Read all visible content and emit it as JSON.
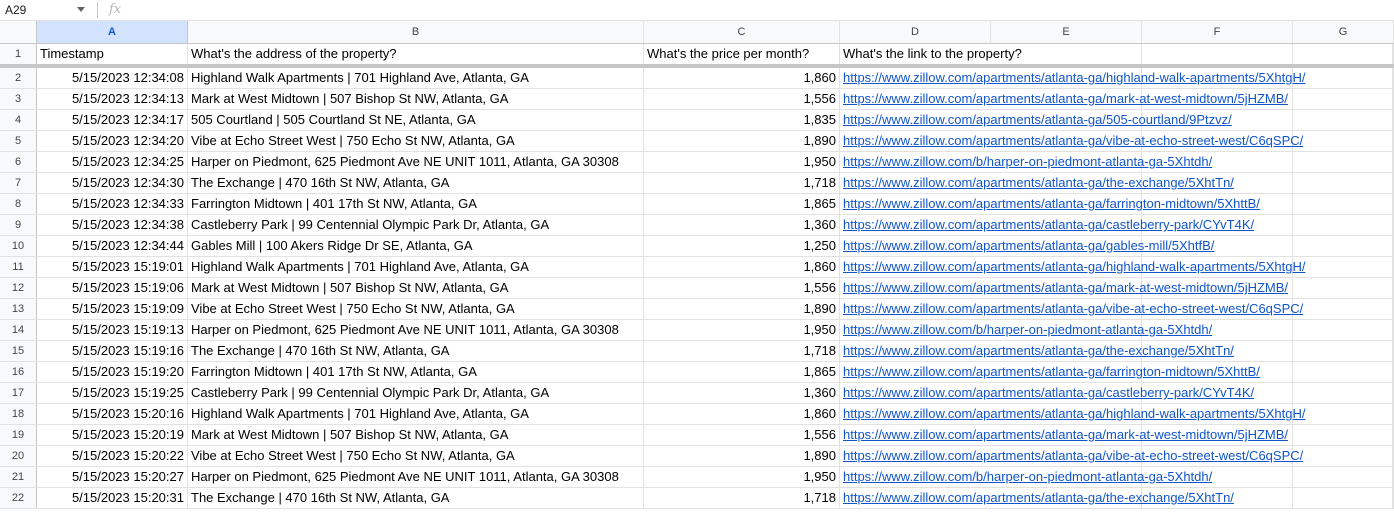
{
  "formula_bar": {
    "name_box": "A29",
    "fx_label": "fx",
    "formula": ""
  },
  "columns": [
    "A",
    "B",
    "C",
    "D",
    "E",
    "F",
    "G"
  ],
  "selected_column": "A",
  "header_row": {
    "row_number": "1",
    "A": "Timestamp",
    "B": "What's the address of the property?",
    "C": "What's the price per month?",
    "D": "What's the link to the property?"
  },
  "rows": [
    {
      "n": "2",
      "timestamp": "5/15/2023 12:34:08",
      "address": "Highland Walk Apartments | 701 Highland Ave, Atlanta, GA",
      "price": "1,860",
      "link": "https://www.zillow.com/apartments/atlanta-ga/highland-walk-apartments/5XhtgH/"
    },
    {
      "n": "3",
      "timestamp": "5/15/2023 12:34:13",
      "address": "Mark at West Midtown | 507 Bishop St NW, Atlanta, GA",
      "price": "1,556",
      "link": "https://www.zillow.com/apartments/atlanta-ga/mark-at-west-midtown/5jHZMB/"
    },
    {
      "n": "4",
      "timestamp": "5/15/2023 12:34:17",
      "address": "505 Courtland | 505 Courtland St NE, Atlanta, GA",
      "price": "1,835",
      "link": "https://www.zillow.com/apartments/atlanta-ga/505-courtland/9Ptzvz/"
    },
    {
      "n": "5",
      "timestamp": "5/15/2023 12:34:20",
      "address": "Vibe at Echo Street West | 750 Echo St NW, Atlanta, GA",
      "price": "1,890",
      "link": "https://www.zillow.com/apartments/atlanta-ga/vibe-at-echo-street-west/C6qSPC/"
    },
    {
      "n": "6",
      "timestamp": "5/15/2023 12:34:25",
      "address": "Harper on Piedmont, 625 Piedmont Ave NE UNIT 1011, Atlanta, GA 30308",
      "price": "1,950",
      "link": "https://www.zillow.com/b/harper-on-piedmont-atlanta-ga-5Xhtdh/"
    },
    {
      "n": "7",
      "timestamp": "5/15/2023 12:34:30",
      "address": "The Exchange | 470 16th St NW, Atlanta, GA",
      "price": "1,718",
      "link": "https://www.zillow.com/apartments/atlanta-ga/the-exchange/5XhtTn/"
    },
    {
      "n": "8",
      "timestamp": "5/15/2023 12:34:33",
      "address": "Farrington Midtown | 401 17th St NW, Atlanta, GA",
      "price": "1,865",
      "link": "https://www.zillow.com/apartments/atlanta-ga/farrington-midtown/5XhttB/"
    },
    {
      "n": "9",
      "timestamp": "5/15/2023 12:34:38",
      "address": "Castleberry Park | 99 Centennial Olympic Park Dr, Atlanta, GA",
      "price": "1,360",
      "link": "https://www.zillow.com/apartments/atlanta-ga/castleberry-park/CYvT4K/"
    },
    {
      "n": "10",
      "timestamp": "5/15/2023 12:34:44",
      "address": "Gables Mill | 100 Akers Ridge Dr SE, Atlanta, GA",
      "price": "1,250",
      "link": "https://www.zillow.com/apartments/atlanta-ga/gables-mill/5XhtfB/"
    },
    {
      "n": "11",
      "timestamp": "5/15/2023 15:19:01",
      "address": "Highland Walk Apartments | 701 Highland Ave, Atlanta, GA",
      "price": "1,860",
      "link": "https://www.zillow.com/apartments/atlanta-ga/highland-walk-apartments/5XhtgH/"
    },
    {
      "n": "12",
      "timestamp": "5/15/2023 15:19:06",
      "address": "Mark at West Midtown | 507 Bishop St NW, Atlanta, GA",
      "price": "1,556",
      "link": "https://www.zillow.com/apartments/atlanta-ga/mark-at-west-midtown/5jHZMB/"
    },
    {
      "n": "13",
      "timestamp": "5/15/2023 15:19:09",
      "address": "Vibe at Echo Street West | 750 Echo St NW, Atlanta, GA",
      "price": "1,890",
      "link": "https://www.zillow.com/apartments/atlanta-ga/vibe-at-echo-street-west/C6qSPC/"
    },
    {
      "n": "14",
      "timestamp": "5/15/2023 15:19:13",
      "address": "Harper on Piedmont, 625 Piedmont Ave NE UNIT 1011, Atlanta, GA 30308",
      "price": "1,950",
      "link": "https://www.zillow.com/b/harper-on-piedmont-atlanta-ga-5Xhtdh/"
    },
    {
      "n": "15",
      "timestamp": "5/15/2023 15:19:16",
      "address": "The Exchange | 470 16th St NW, Atlanta, GA",
      "price": "1,718",
      "link": "https://www.zillow.com/apartments/atlanta-ga/the-exchange/5XhtTn/"
    },
    {
      "n": "16",
      "timestamp": "5/15/2023 15:19:20",
      "address": "Farrington Midtown | 401 17th St NW, Atlanta, GA",
      "price": "1,865",
      "link": "https://www.zillow.com/apartments/atlanta-ga/farrington-midtown/5XhttB/"
    },
    {
      "n": "17",
      "timestamp": "5/15/2023 15:19:25",
      "address": "Castleberry Park | 99 Centennial Olympic Park Dr, Atlanta, GA",
      "price": "1,360",
      "link": "https://www.zillow.com/apartments/atlanta-ga/castleberry-park/CYvT4K/"
    },
    {
      "n": "18",
      "timestamp": "5/15/2023 15:20:16",
      "address": "Highland Walk Apartments | 701 Highland Ave, Atlanta, GA",
      "price": "1,860",
      "link": "https://www.zillow.com/apartments/atlanta-ga/highland-walk-apartments/5XhtgH/"
    },
    {
      "n": "19",
      "timestamp": "5/15/2023 15:20:19",
      "address": "Mark at West Midtown | 507 Bishop St NW, Atlanta, GA",
      "price": "1,556",
      "link": "https://www.zillow.com/apartments/atlanta-ga/mark-at-west-midtown/5jHZMB/"
    },
    {
      "n": "20",
      "timestamp": "5/15/2023 15:20:22",
      "address": "Vibe at Echo Street West | 750 Echo St NW, Atlanta, GA",
      "price": "1,890",
      "link": "https://www.zillow.com/apartments/atlanta-ga/vibe-at-echo-street-west/C6qSPC/"
    },
    {
      "n": "21",
      "timestamp": "5/15/2023 15:20:27",
      "address": "Harper on Piedmont, 625 Piedmont Ave NE UNIT 1011, Atlanta, GA 30308",
      "price": "1,950",
      "link": "https://www.zillow.com/b/harper-on-piedmont-atlanta-ga-5Xhtdh/"
    },
    {
      "n": "22",
      "timestamp": "5/15/2023 15:20:31",
      "address": "The Exchange | 470 16th St NW, Atlanta, GA",
      "price": "1,718",
      "link": "https://www.zillow.com/apartments/atlanta-ga/the-exchange/5XhtTn/"
    }
  ],
  "colors": {
    "link": "#1155cc",
    "selected_header_bg": "#d3e3fd",
    "selected_header_text": "#0b57d0",
    "header_bg": "#f8f9fa",
    "gridline": "#e2e2e2"
  }
}
